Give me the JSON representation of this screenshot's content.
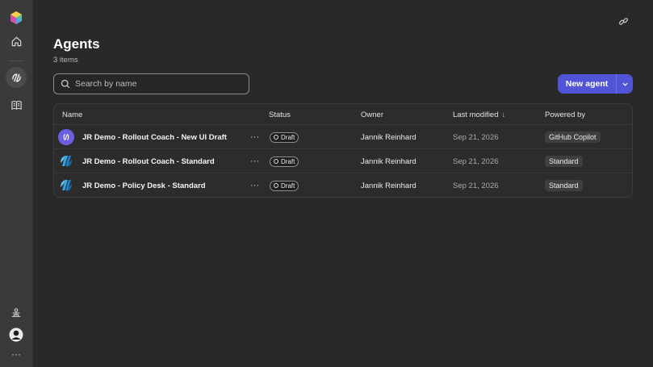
{
  "colors": {
    "accent": "#4f55d6",
    "background": "#292929",
    "rail": "#3a3a3a"
  },
  "rail": {
    "icons": [
      "app-logo-icon",
      "home-icon",
      "agents-icon",
      "library-icon",
      "accessibility-icon",
      "user-avatar",
      "more-icon"
    ]
  },
  "header": {
    "title": "Agents",
    "count": "3 items"
  },
  "search": {
    "placeholder": "Search by name"
  },
  "toolbar": {
    "new_agent_label": "New agent"
  },
  "table": {
    "columns": {
      "name": "Name",
      "status": "Status",
      "owner": "Owner",
      "last_modified": "Last modified",
      "powered_by": "Powered by"
    },
    "sort_indicator": "↓",
    "rows": [
      {
        "name": "JR Demo - Rollout Coach - New UI Draft",
        "more": "···",
        "status": "Draft",
        "owner": "Jannik Reinhard",
        "modified": "Sep 21, 2026",
        "powered_by": "GitHub Copilot",
        "icon": "copilot-icon"
      },
      {
        "name": "JR Demo - Rollout Coach - Standard",
        "more": "···",
        "status": "Draft",
        "owner": "Jannik Reinhard",
        "modified": "Sep 21, 2026",
        "powered_by": "Standard",
        "icon": "studio-icon"
      },
      {
        "name": "JR Demo - Policy Desk - Standard",
        "more": "···",
        "status": "Draft",
        "owner": "Jannik Reinhard",
        "modified": "Sep 21, 2026",
        "powered_by": "Standard",
        "icon": "studio-icon"
      }
    ]
  }
}
